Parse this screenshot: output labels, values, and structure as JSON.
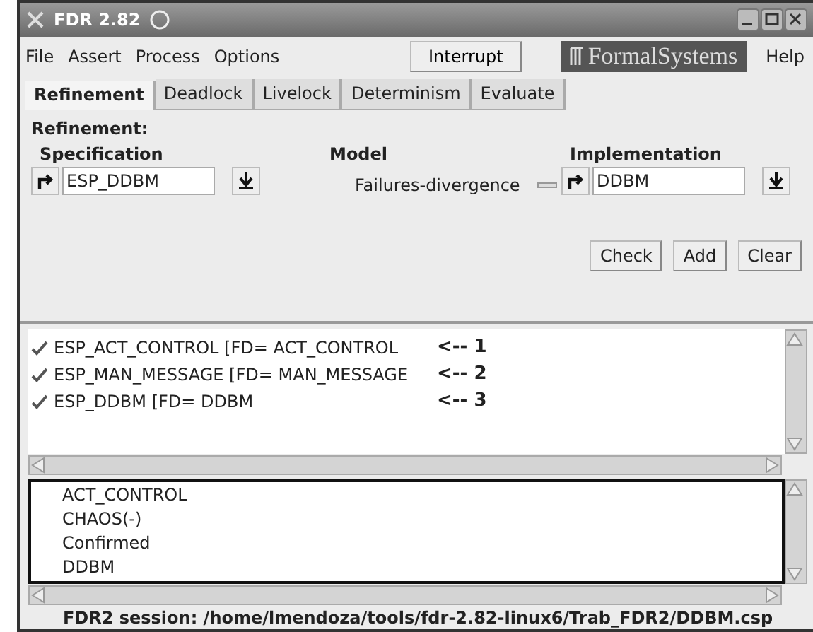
{
  "window": {
    "title": "FDR 2.82"
  },
  "menu": [
    {
      "label": "File"
    },
    {
      "label": "Assert"
    },
    {
      "label": "Process"
    },
    {
      "label": "Options"
    }
  ],
  "interrupt_button": "Interrupt",
  "logo": "FormalSystems",
  "help_menu": "Help",
  "tabs": [
    {
      "label": "Refinement",
      "selected": true
    },
    {
      "label": "Deadlock",
      "selected": false
    },
    {
      "label": "Livelock",
      "selected": false
    },
    {
      "label": "Determinism",
      "selected": false
    },
    {
      "label": "Evaluate",
      "selected": false
    }
  ],
  "panel": {
    "heading": "Refinement:",
    "specification": {
      "label": "Specification",
      "value": "ESP_DDBM"
    },
    "model": {
      "label": "Model",
      "value": "Failures-divergence"
    },
    "implementation": {
      "label": "Implementation",
      "value": "DDBM"
    },
    "buttons": [
      "Check",
      "Add",
      "Clear"
    ]
  },
  "assertions": [
    {
      "text": "ESP_ACT_CONTROL [FD= ACT_CONTROL",
      "passed": true,
      "note": "<-- 1"
    },
    {
      "text": "ESP_MAN_MESSAGE [FD= MAN_MESSAGE",
      "passed": true,
      "note": "<-- 2"
    },
    {
      "text": "ESP_DDBM [FD= DDBM",
      "passed": true,
      "note": "<-- 3"
    }
  ],
  "processes": [
    "ACT_CONTROL",
    "CHAOS(-)",
    "Confirmed",
    "DDBM"
  ],
  "status_bar": "FDR2 session: /home/lmendoza/tools/fdr-2.82-linux6/Trab_FDR2/DDBM.csp"
}
